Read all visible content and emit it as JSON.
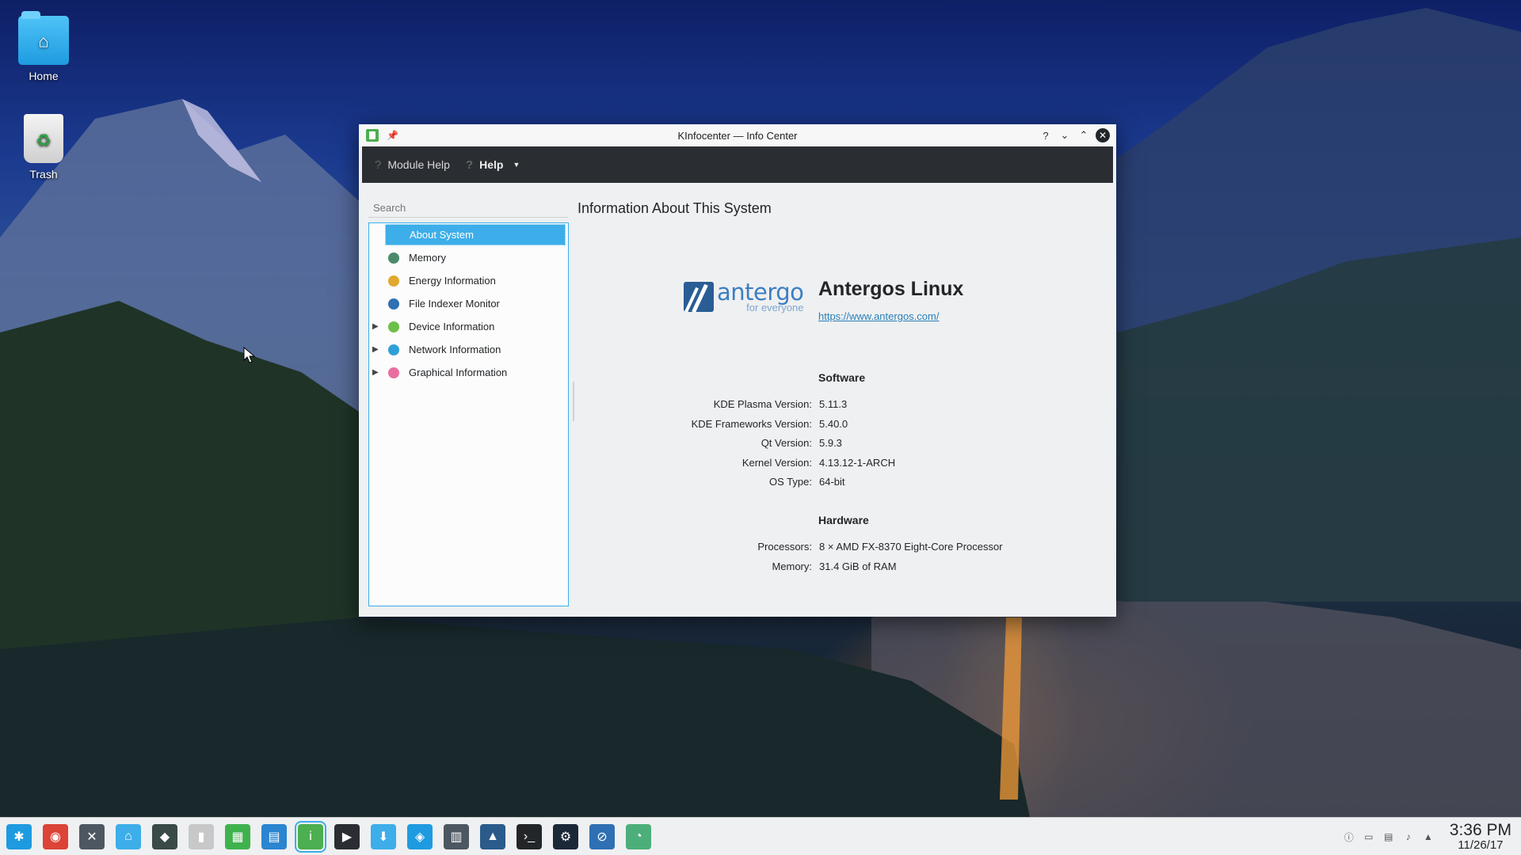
{
  "desktop": {
    "icons": [
      {
        "label": "Home"
      },
      {
        "label": "Trash"
      }
    ]
  },
  "window": {
    "title": "KInfocenter — Info Center",
    "controls": {
      "help": "?",
      "minimize": "⌄",
      "maximize": "⌃",
      "close": "✕"
    },
    "toolbar": {
      "module_help": "Module Help",
      "help": "Help"
    },
    "sidebar": {
      "search_placeholder": "Search",
      "items": [
        {
          "label": "About System",
          "expandable": false,
          "selected": true,
          "icon": "info-icon",
          "color": "#3daee9"
        },
        {
          "label": "Memory",
          "expandable": false,
          "selected": false,
          "icon": "memory-icon",
          "color": "#4a8a6a"
        },
        {
          "label": "Energy Information",
          "expandable": false,
          "selected": false,
          "icon": "energy-icon",
          "color": "#e0a82e"
        },
        {
          "label": "File Indexer Monitor",
          "expandable": false,
          "selected": false,
          "icon": "file-indexer-icon",
          "color": "#2f6fb3"
        },
        {
          "label": "Device Information",
          "expandable": true,
          "selected": false,
          "icon": "device-icon",
          "color": "#6cc04a"
        },
        {
          "label": "Network Information",
          "expandable": true,
          "selected": false,
          "icon": "network-icon",
          "color": "#2f9fd8"
        },
        {
          "label": "Graphical Information",
          "expandable": true,
          "selected": false,
          "icon": "graphics-icon",
          "color": "#e86fa0"
        }
      ]
    },
    "main": {
      "heading": "Information About This System",
      "logo": {
        "wordmark": "antergo",
        "tagline": "for everyone"
      },
      "distro_name": "Antergos Linux",
      "distro_url": "https://www.antergos.com/",
      "software": {
        "title": "Software",
        "rows": [
          {
            "key": "KDE Plasma Version:",
            "value": "5.11.3"
          },
          {
            "key": "KDE Frameworks Version:",
            "value": "5.40.0"
          },
          {
            "key": "Qt Version:",
            "value": "5.9.3"
          },
          {
            "key": "Kernel Version:",
            "value": "4.13.12-1-ARCH"
          },
          {
            "key": "OS Type:",
            "value": "64-bit"
          }
        ]
      },
      "hardware": {
        "title": "Hardware",
        "rows": [
          {
            "key": "Processors:",
            "value": "8 × AMD FX-8370 Eight-Core Processor"
          },
          {
            "key": "Memory:",
            "value": "31.4 GiB of RAM"
          }
        ]
      }
    }
  },
  "taskbar": {
    "apps": [
      {
        "name": "application-launcher",
        "color": "#1e9be0",
        "glyph": "✱"
      },
      {
        "name": "chrome",
        "color": "#db4437",
        "glyph": "◉"
      },
      {
        "name": "system-settings",
        "color": "#4d5761",
        "glyph": "✕"
      },
      {
        "name": "file-manager",
        "color": "#3daee9",
        "glyph": "⌂"
      },
      {
        "name": "inkscape",
        "color": "#3a4a46",
        "glyph": "◆"
      },
      {
        "name": "presentation",
        "color": "#c8c8c8",
        "glyph": "▮"
      },
      {
        "name": "spreadsheet",
        "color": "#3fb24d",
        "glyph": "▦"
      },
      {
        "name": "document",
        "color": "#2b85d0",
        "glyph": "▤"
      },
      {
        "name": "kinfocenter",
        "color": "#4caf50",
        "glyph": "i",
        "active": true
      },
      {
        "name": "media-player",
        "color": "#2a2e32",
        "glyph": "▶"
      },
      {
        "name": "downloader",
        "color": "#3daee9",
        "glyph": "⬇"
      },
      {
        "name": "package-manager",
        "color": "#1e9be0",
        "glyph": "◈"
      },
      {
        "name": "calculator",
        "color": "#4d5761",
        "glyph": "▥"
      },
      {
        "name": "image-viewer",
        "color": "#2b5b8a",
        "glyph": "▲"
      },
      {
        "name": "terminal",
        "color": "#232629",
        "glyph": "›_"
      },
      {
        "name": "steam",
        "color": "#1b2838",
        "glyph": "⚙"
      },
      {
        "name": "browser",
        "color": "#2f6fb3",
        "glyph": "⊘"
      },
      {
        "name": "antergos-updater",
        "color": "#4caf7a",
        "glyph": "◔"
      }
    ],
    "tray": {
      "icons": [
        "notifications-icon",
        "display-icon",
        "clipboard-icon",
        "volume-icon",
        "expand-tray-icon"
      ],
      "time": "3:36 PM",
      "date": "11/26/17"
    }
  }
}
